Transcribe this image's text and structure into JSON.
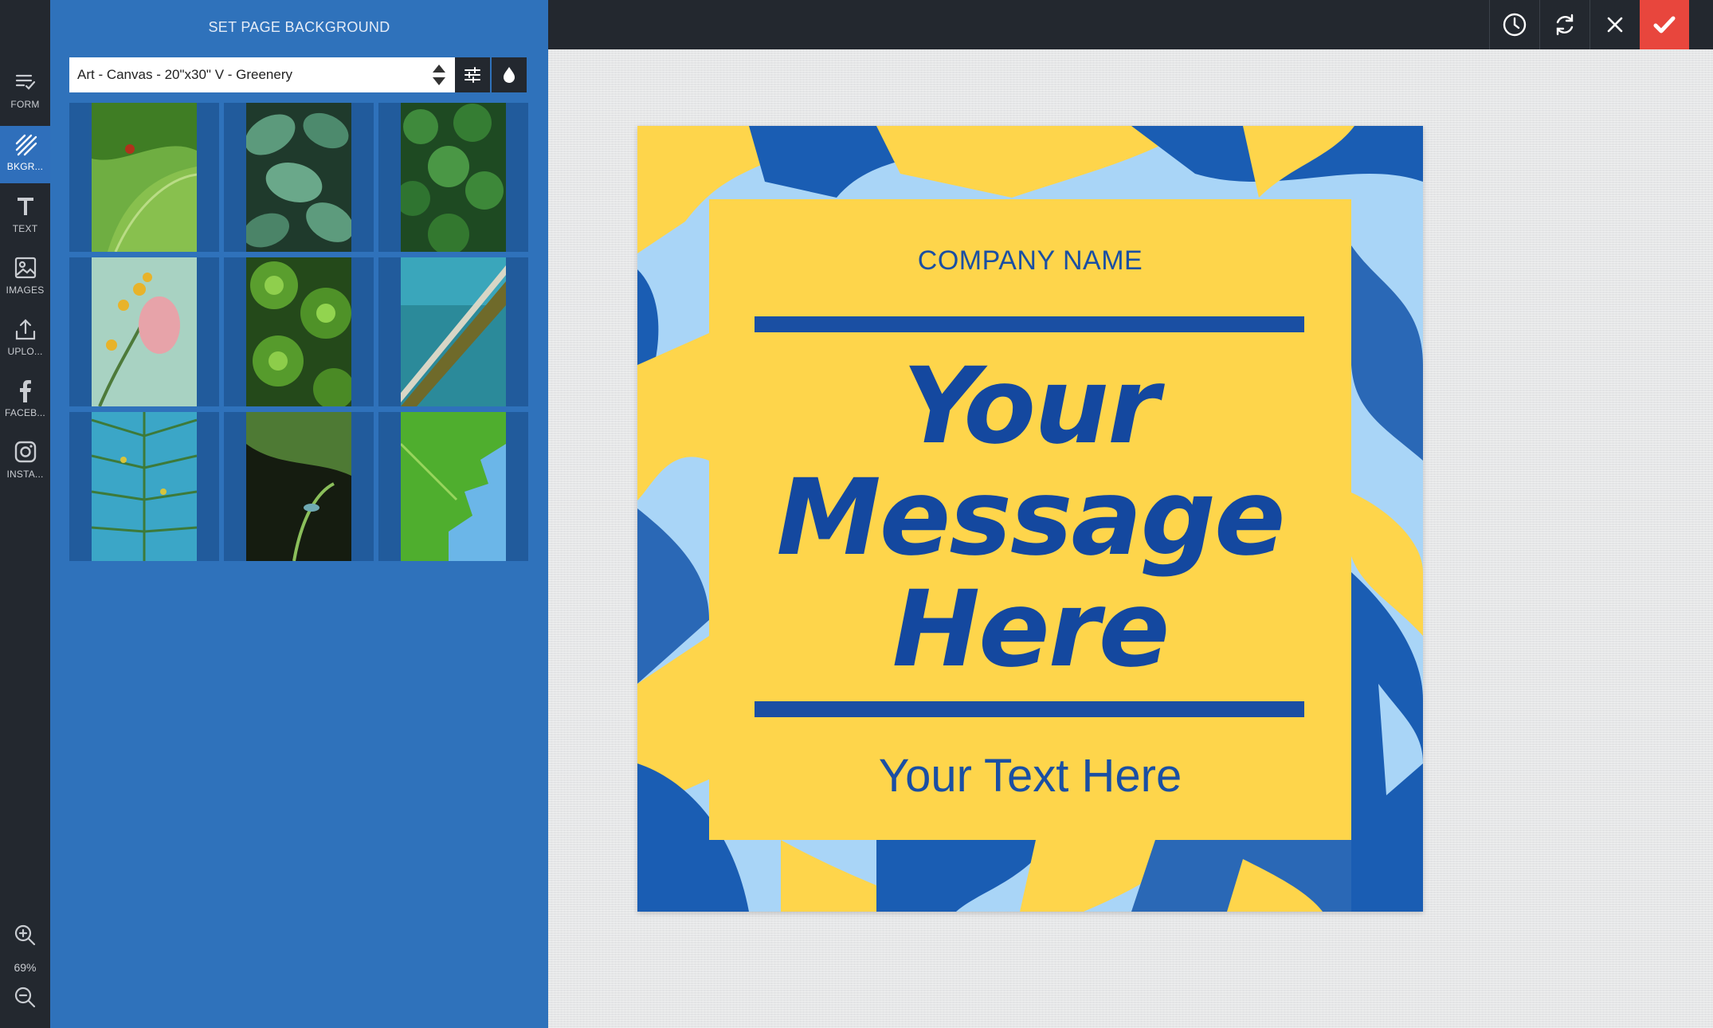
{
  "rail": {
    "items": [
      {
        "label": "FORM",
        "icon": "form-icon"
      },
      {
        "label": "BKGR...",
        "icon": "background-icon",
        "active": true
      },
      {
        "label": "TEXT",
        "icon": "text-icon"
      },
      {
        "label": "IMAGES",
        "icon": "image-icon"
      },
      {
        "label": "UPLO...",
        "icon": "upload-icon"
      },
      {
        "label": "FACEB...",
        "icon": "facebook-icon"
      },
      {
        "label": "INSTA...",
        "icon": "instagram-icon"
      }
    ],
    "zoom": "69%"
  },
  "panel": {
    "title": "SET PAGE BACKGROUND",
    "select_value": "Art - Canvas - 20\"x30\" V - Greenery",
    "thumbnails": [
      {
        "name": "ladybug-leaf",
        "color": "#5fa53a"
      },
      {
        "name": "striped-leaves",
        "color": "#3d6f55"
      },
      {
        "name": "dark-clover-leaves",
        "color": "#2e6b2f"
      },
      {
        "name": "pink-flower",
        "color": "#a9cfc0"
      },
      {
        "name": "green-rosettes",
        "color": "#4f8d2a"
      },
      {
        "name": "palm-frond-sky",
        "color": "#2f7f88"
      },
      {
        "name": "palm-leaves-blue-sky",
        "color": "#3b97b4"
      },
      {
        "name": "fern-lizard",
        "color": "#27331d"
      },
      {
        "name": "maple-leaf-sky",
        "color": "#57b63a"
      }
    ]
  },
  "topbar": {
    "buttons": [
      "history-icon",
      "refresh-icon",
      "close-icon",
      "check-icon"
    ]
  },
  "canvas": {
    "company": "COMPANY NAME",
    "message_lines": [
      "Your",
      "Message",
      "Here"
    ],
    "subtext": "Your Text Here",
    "colors": {
      "yellow": "#fed54b",
      "blue": "#1a4fa3",
      "light_blue": "#a9d5f7",
      "mid_blue": "#2a68b6"
    }
  }
}
